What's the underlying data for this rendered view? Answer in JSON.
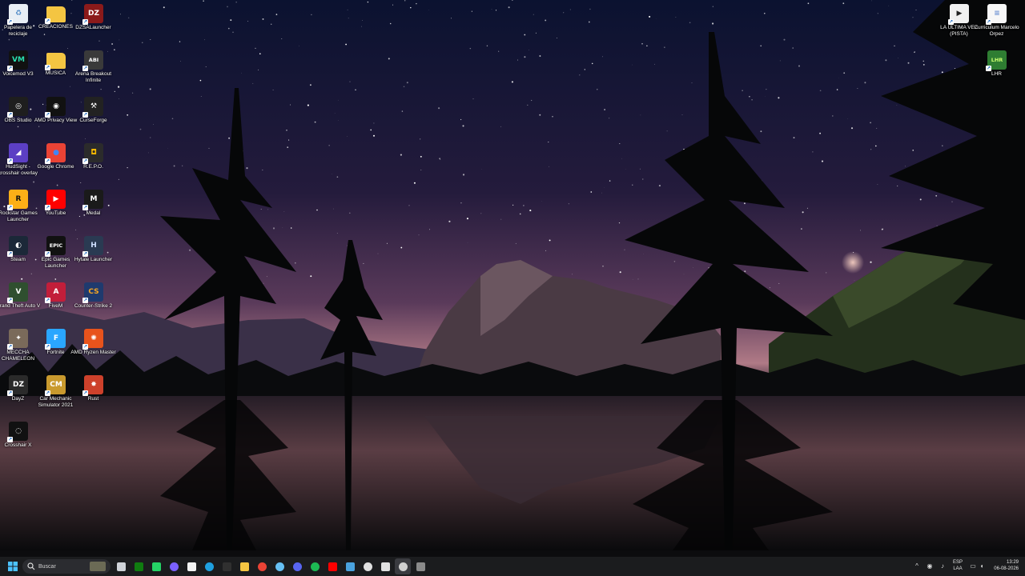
{
  "desktop": {
    "left_icons": [
      {
        "label": "Papelera de reciclaje",
        "icon": "recycle-bin-icon",
        "color": "#e8eef5",
        "glyph": "♻",
        "fg": "#4a86c5"
      },
      {
        "label": "CREACIONES",
        "icon": "folder-icon",
        "color": "#f4c542",
        "glyph": "",
        "fg": "#fff"
      },
      {
        "label": "DZSALauncher",
        "icon": "dzsa-launcher-icon",
        "color": "#8b1a1a",
        "glyph": "DZ",
        "fg": "#fff"
      },
      {
        "label": "Voicemod V3",
        "icon": "voicemod-icon",
        "color": "#111111",
        "glyph": "VM",
        "fg": "#29e0b0"
      },
      {
        "label": "MUSICA",
        "icon": "folder-icon",
        "color": "#f4c542",
        "glyph": "",
        "fg": "#fff"
      },
      {
        "label": "Arena Breakout Infinite",
        "icon": "arena-breakout-icon",
        "color": "#3a3a3a",
        "glyph": "ABI",
        "fg": "#fff"
      },
      {
        "label": "OBS Studio",
        "icon": "obs-icon",
        "color": "#1e1e1e",
        "glyph": "◎",
        "fg": "#fff"
      },
      {
        "label": "AMD Privacy View",
        "icon": "amd-privacy-view-icon",
        "color": "#111111",
        "glyph": "◉",
        "fg": "#fff"
      },
      {
        "label": "CurseForge",
        "icon": "curseforge-icon",
        "color": "#222222",
        "glyph": "⚒",
        "fg": "#fff"
      },
      {
        "label": "HudSight - crosshair overlay",
        "icon": "hudsight-icon",
        "color": "#5c3fc4",
        "glyph": "◢",
        "fg": "#fff"
      },
      {
        "label": "Google Chrome",
        "icon": "chrome-icon",
        "color": "#ea4335",
        "glyph": "●",
        "fg": "#4285f4"
      },
      {
        "label": "R.E.P.O.",
        "icon": "repo-icon",
        "color": "#2b2b2b",
        "glyph": "◘",
        "fg": "#f5b800"
      },
      {
        "label": "Rockstar Games Launcher",
        "icon": "rockstar-icon",
        "color": "#fcaf17",
        "glyph": "R",
        "fg": "#111"
      },
      {
        "label": "YouTube",
        "icon": "youtube-icon",
        "color": "#ff0000",
        "glyph": "▶",
        "fg": "#fff"
      },
      {
        "label": "Medal",
        "icon": "medal-icon",
        "color": "#1a1a1a",
        "glyph": "M",
        "fg": "#fff"
      },
      {
        "label": "Steam",
        "icon": "steam-icon",
        "color": "#1b2838",
        "glyph": "◐",
        "fg": "#fff"
      },
      {
        "label": "Epic Games Launcher",
        "icon": "epic-games-icon",
        "color": "#111111",
        "glyph": "EPIC",
        "fg": "#fff"
      },
      {
        "label": "Hytale Launcher",
        "icon": "hytale-icon",
        "color": "#2a3a52",
        "glyph": "H",
        "fg": "#cfe0ff"
      },
      {
        "label": "Grand Theft Auto V",
        "icon": "gta-v-icon",
        "color": "#2f4f2f",
        "glyph": "V",
        "fg": "#fff"
      },
      {
        "label": "FiveM",
        "icon": "fivem-icon",
        "color": "#c21e3a",
        "glyph": "A",
        "fg": "#fff"
      },
      {
        "label": "Counter-Strike 2",
        "icon": "counter-strike-icon",
        "color": "#1f3a6e",
        "glyph": "CS",
        "fg": "#f5a623"
      },
      {
        "label": "MECCHA CHAMELEON",
        "icon": "meccha-chameleon-icon",
        "color": "#7a6a5a",
        "glyph": "✦",
        "fg": "#fff"
      },
      {
        "label": "Fortnite",
        "icon": "fortnite-icon",
        "color": "#2aa6ff",
        "glyph": "F",
        "fg": "#fff"
      },
      {
        "label": "AMD Ryzen Master",
        "icon": "ryzen-master-icon",
        "color": "#e8531c",
        "glyph": "✺",
        "fg": "#fff"
      },
      {
        "label": "DayZ",
        "icon": "dayz-icon",
        "color": "#2a2a2a",
        "glyph": "DZ",
        "fg": "#fff"
      },
      {
        "label": "Car Mechanic Simulator 2021",
        "icon": "car-mechanic-icon",
        "color": "#c99a2e",
        "glyph": "CM",
        "fg": "#fff"
      },
      {
        "label": "Rust",
        "icon": "rust-icon",
        "color": "#cd412b",
        "glyph": "✸",
        "fg": "#fff"
      },
      {
        "label": "Crosshair X",
        "icon": "crosshair-x-icon",
        "color": "#111111",
        "glyph": "◌",
        "fg": "#fff"
      }
    ],
    "right_icons": [
      {
        "label": "LA ULTIMA VEZ (PISTA)",
        "icon": "media-file-icon",
        "color": "#f1f1f1",
        "glyph": "▶",
        "fg": "#222"
      },
      {
        "label": "Curriculum Marcelo Orpez",
        "icon": "document-icon",
        "color": "#f7f7f7",
        "glyph": "≡",
        "fg": "#6a8fd1"
      },
      {
        "label": "LHR",
        "icon": "lhr-icon",
        "color": "#2e7d32",
        "glyph": "LHR",
        "fg": "#c8ff6e"
      }
    ]
  },
  "taskbar": {
    "search_placeholder": "Buscar",
    "pinned": [
      {
        "icon": "task-view-icon",
        "color": "#cfd3d8"
      },
      {
        "icon": "xbox-app-icon",
        "color": "#107c10"
      },
      {
        "icon": "whatsapp-icon",
        "color": "#25d366"
      },
      {
        "icon": "copilot-icon",
        "color": "#7b61ff"
      },
      {
        "icon": "microsoft-store-icon",
        "color": "#f3f3f3"
      },
      {
        "icon": "edge-icon",
        "color": "#1fa0e0"
      },
      {
        "icon": "terminal-icon",
        "color": "#303030"
      },
      {
        "icon": "file-explorer-icon",
        "color": "#f4c542"
      },
      {
        "icon": "chrome-icon",
        "color": "#ea4335"
      },
      {
        "icon": "steam-icon",
        "color": "#66c0f4"
      },
      {
        "icon": "discord-icon",
        "color": "#5865f2"
      },
      {
        "icon": "spotify-icon",
        "color": "#1db954"
      },
      {
        "icon": "youtube-icon",
        "color": "#ff0000"
      },
      {
        "icon": "steam-alt-icon",
        "color": "#4aa3df"
      },
      {
        "icon": "crosshair-x-icon",
        "color": "#e0e0e0"
      },
      {
        "icon": "epic-games-icon",
        "color": "#e0e0e0"
      },
      {
        "icon": "obs-icon",
        "color": "#d0d0d0"
      },
      {
        "icon": "hytale-icon",
        "color": "#8a8a8a"
      }
    ],
    "language_line1": "ESP",
    "language_line2": "LAA",
    "time": "13:29",
    "date": "06-08-2026"
  }
}
